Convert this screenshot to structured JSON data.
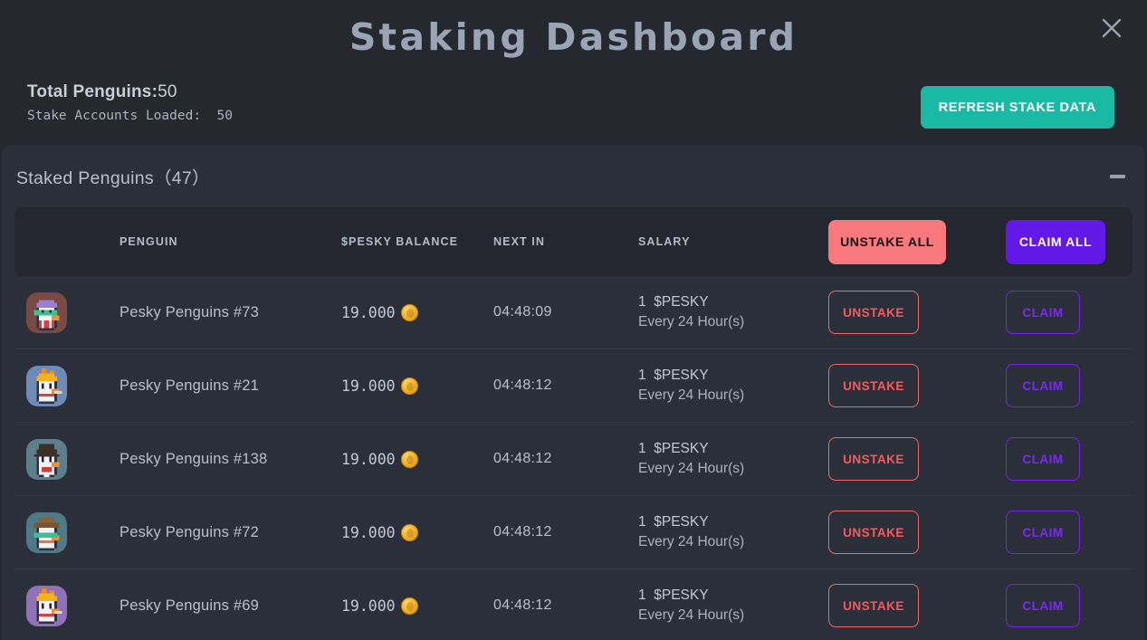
{
  "header": {
    "title": "Staking Dashboard",
    "close_icon": "close-icon",
    "total_penguins_label": "Total Penguins:",
    "total_penguins_value": "50",
    "stake_accounts_loaded": "Stake Accounts Loaded:  50",
    "refresh_label": "REFRESH STAKE DATA",
    "refresh_color": "#1ab9a3"
  },
  "panel": {
    "title": "Staked Penguins（47）",
    "collapse_icon": "minus-icon"
  },
  "table": {
    "columns": {
      "penguin": "PENGUIN",
      "balance": "$PESKY BALANCE",
      "next_in": "NEXT IN",
      "salary": "SALARY"
    },
    "unstake_all_label": "UNSTAKE ALL",
    "claim_all_label": "CLAIM ALL",
    "unstake_all_color": "#f8797b",
    "claim_all_color": "#6219e8",
    "row_unstake_label": "UNSTAKE",
    "row_claim_label": "CLAIM",
    "rows": [
      {
        "name": "Pesky Penguins #73",
        "balance": "19.000",
        "balance_icon": "coin-icon",
        "next_in": "04:48:09",
        "salary_amount": "1  $PESKY",
        "salary_period": "Every 24 Hour(s)",
        "avatar": "penguin-purple-hair-green-mask",
        "avatar_bg": "#7a4a42"
      },
      {
        "name": "Pesky Penguins #21",
        "balance": "19.000",
        "balance_icon": "coin-icon",
        "next_in": "04:48:12",
        "salary_amount": "1  $PESKY",
        "salary_period": "Every 24 Hour(s)",
        "avatar": "penguin-flame-hair-cigarette",
        "avatar_bg": "#6d8ab8"
      },
      {
        "name": "Pesky Penguins #138",
        "balance": "19.000",
        "balance_icon": "coin-icon",
        "next_in": "04:48:12",
        "salary_amount": "1  $PESKY",
        "salary_period": "Every 24 Hour(s)",
        "avatar": "penguin-fedora-bowtie",
        "avatar_bg": "#5d7f8c"
      },
      {
        "name": "Pesky Penguins #72",
        "balance": "19.000",
        "balance_icon": "coin-icon",
        "next_in": "04:48:12",
        "salary_amount": "1  $PESKY",
        "salary_period": "Every 24 Hour(s)",
        "avatar": "penguin-cowboy-hat-green-bandana",
        "avatar_bg": "#4e7a86"
      },
      {
        "name": "Pesky Penguins #69",
        "balance": "19.000",
        "balance_icon": "coin-icon",
        "next_in": "04:48:12",
        "salary_amount": "1  $PESKY",
        "salary_period": "Every 24 Hour(s)",
        "avatar": "penguin-flame-hair-purple-bg",
        "avatar_bg": "#8f72b8"
      }
    ]
  }
}
